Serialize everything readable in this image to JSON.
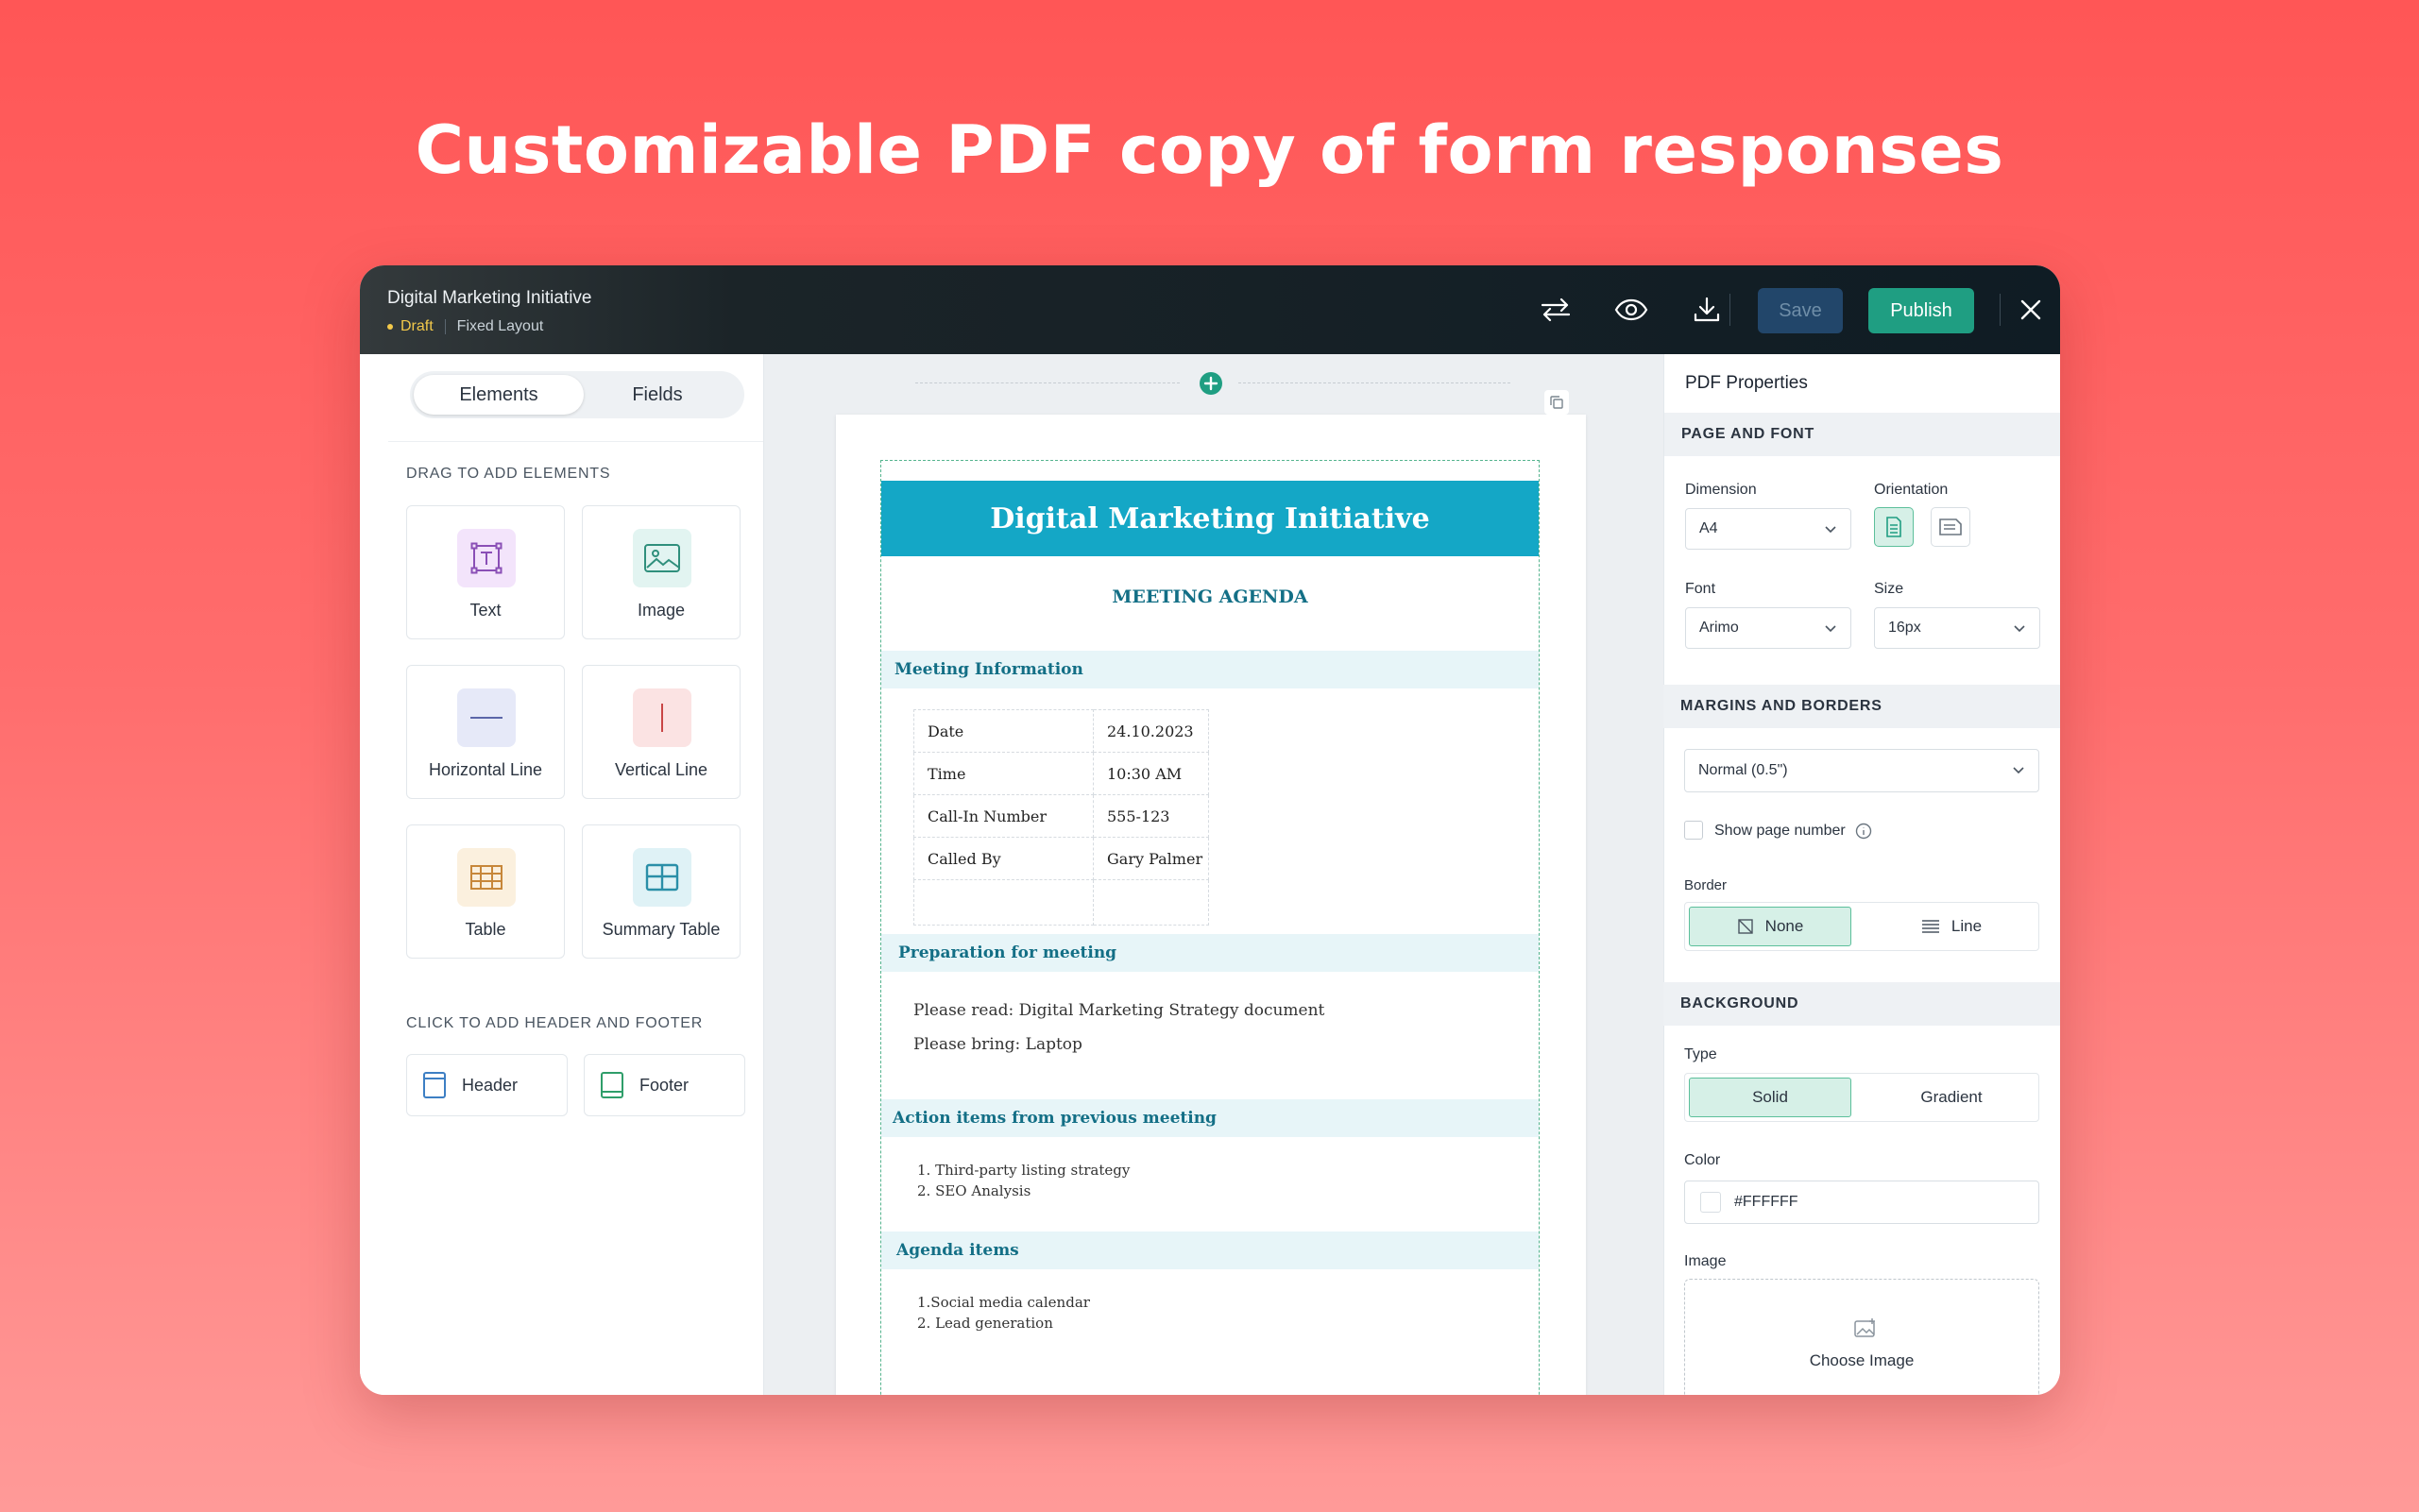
{
  "headline": "Customizable PDF copy of form responses",
  "topbar": {
    "title": "Digital Marketing Initiative",
    "status": "Draft",
    "layout": "Fixed Layout",
    "save_label": "Save",
    "publish_label": "Publish",
    "icons": [
      "swap-arrows-icon",
      "eye-icon",
      "download-icon",
      "close-icon"
    ]
  },
  "left_panel": {
    "tabs": [
      {
        "label": "Elements",
        "active": true
      },
      {
        "label": "Fields",
        "active": false
      }
    ],
    "drag_label": "DRAG TO ADD ELEMENTS",
    "elements": [
      {
        "label": "Text",
        "icon": "text-icon"
      },
      {
        "label": "Image",
        "icon": "image-icon"
      },
      {
        "label": "Horizontal Line",
        "icon": "horizontal-line-icon"
      },
      {
        "label": "Vertical Line",
        "icon": "vertical-line-icon"
      },
      {
        "label": "Table",
        "icon": "table-icon"
      },
      {
        "label": "Summary Table",
        "icon": "summary-table-icon"
      }
    ],
    "header_footer_label": "CLICK TO ADD HEADER AND FOOTER",
    "header_label": "Header",
    "footer_label": "Footer"
  },
  "document": {
    "banner": "Digital Marketing Initiative",
    "subtitle": "MEETING AGENDA",
    "sections": {
      "meeting_info": "Meeting Information",
      "preparation": "Preparation for meeting",
      "action_items": "Action items from previous meeting",
      "agenda_items": "Agenda items"
    },
    "info_rows": [
      {
        "key": "Date",
        "value": "24.10.2023"
      },
      {
        "key": "Time",
        "value": "10:30 AM"
      },
      {
        "key": "Call-In Number",
        "value": "555-123"
      },
      {
        "key": "Called By",
        "value": "Gary Palmer"
      }
    ],
    "preparation_lines": [
      "Please read: Digital Marketing Strategy document",
      "Please bring: Laptop"
    ],
    "action_lines": [
      "1. Third-party listing strategy",
      "2. SEO Analysis"
    ],
    "agenda_lines": [
      "1.Social media calendar",
      "2. Lead generation"
    ]
  },
  "right_panel": {
    "title": "PDF Properties",
    "page_font_band": "PAGE AND FONT",
    "dimension_label": "Dimension",
    "dimension_value": "A4",
    "orientation_label": "Orientation",
    "orientation_selected": "portrait",
    "font_label": "Font",
    "font_value": "Arimo",
    "size_label": "Size",
    "size_value": "16px",
    "margins_band": "MARGINS AND BORDERS",
    "margin_value": "Normal (0.5\")",
    "show_page_number": "Show page number",
    "show_page_number_checked": false,
    "border_label": "Border",
    "border_none": "None",
    "border_line": "Line",
    "border_selected": "None",
    "background_band": "BACKGROUND",
    "type_label": "Type",
    "type_solid": "Solid",
    "type_gradient": "Gradient",
    "type_selected": "Solid",
    "color_label": "Color",
    "color_value": "#FFFFFF",
    "image_label": "Image",
    "choose_image": "Choose Image"
  },
  "colors": {
    "accent_green": "#1f9e82",
    "doc_banner": "#14a7c6",
    "doc_heading": "#136f86",
    "draft_yellow": "#f3c94a"
  }
}
